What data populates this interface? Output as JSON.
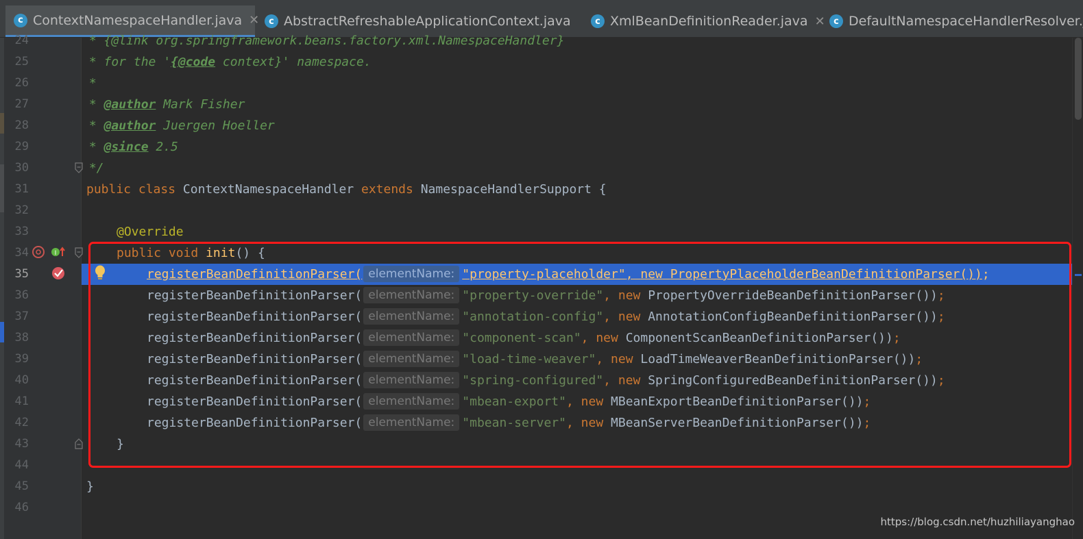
{
  "tabs": [
    {
      "label": "ContextNamespaceHandler.java",
      "icon": "c-class-icon",
      "active": true
    },
    {
      "label": "AbstractRefreshableApplicationContext.java",
      "icon": "c-class-icon",
      "active": false
    },
    {
      "label": "XmlBeanDefinitionReader.java",
      "icon": "c-class-icon",
      "active": false
    },
    {
      "label": "DefaultNamespaceHandlerResolver.j",
      "icon": "c-class-icon",
      "active": false
    }
  ],
  "close_glyph": "✕",
  "class_icon_letter": "c",
  "hint_label": "elementName:",
  "line_numbers": [
    "24",
    "25",
    "26",
    "27",
    "28",
    "29",
    "30",
    "31",
    "32",
    "33",
    "34",
    "35",
    "36",
    "37",
    "38",
    "39",
    "40",
    "41",
    "42",
    "43",
    "44",
    "45",
    "46"
  ],
  "current_line": "35",
  "code": {
    "l24": "{@link org.springframework.beans.factory.xml.NamespaceHandler}",
    "l25_a": " * for the '",
    "l25_tag": "{@code",
    "l25_b": " context}' namespace.",
    "l26": " *",
    "l27_tag": "@author",
    "l27_text": " Mark Fisher",
    "l28_tag": "@author",
    "l28_text": " Juergen Hoeller",
    "l29_tag": "@since",
    "l29_text": " 2.5",
    "l30": " */",
    "l31_public": "public",
    "l31_class": "class",
    "l31_name": "ContextNamespaceHandler",
    "l31_extends": "extends",
    "l31_super": "NamespaceHandlerSupport {",
    "l33_ann": "@Override",
    "l34_public": "public",
    "l34_void": "void",
    "l34_init": "init",
    "l34_rest": "() {",
    "calls": [
      {
        "method": "registerBeanDefinitionParser(",
        "arg": "\"property-placeholder\"",
        "ctor": "PropertyPlaceholderBeanDefinitionParser())",
        "end": ";"
      },
      {
        "method": "registerBeanDefinitionParser(",
        "arg": "\"property-override\"",
        "ctor": "PropertyOverrideBeanDefinitionParser())",
        "end": ";"
      },
      {
        "method": "registerBeanDefinitionParser(",
        "arg": "\"annotation-config\"",
        "ctor": "AnnotationConfigBeanDefinitionParser())",
        "end": ";"
      },
      {
        "method": "registerBeanDefinitionParser(",
        "arg": "\"component-scan\"",
        "ctor": "ComponentScanBeanDefinitionParser())",
        "end": ";"
      },
      {
        "method": "registerBeanDefinitionParser(",
        "arg": "\"load-time-weaver\"",
        "ctor": "LoadTimeWeaverBeanDefinitionParser())",
        "end": ";"
      },
      {
        "method": "registerBeanDefinitionParser(",
        "arg": "\"spring-configured\"",
        "ctor": "SpringConfiguredBeanDefinitionParser())",
        "end": ";"
      },
      {
        "method": "registerBeanDefinitionParser(",
        "arg": "\"mbean-export\"",
        "ctor": "MBeanExportBeanDefinitionParser())",
        "end": ";"
      },
      {
        "method": "registerBeanDefinitionParser(",
        "arg": "\"mbean-server\"",
        "ctor": "MBeanServerBeanDefinitionParser())",
        "end": ";"
      }
    ],
    "comma": ",",
    "new_kw": "new",
    "l43": "}",
    "l45": "}"
  },
  "watermark": "https://blog.csdn.net/huzhiliayanghao",
  "colors": {
    "keyword": "#cc7832",
    "string": "#6a8759",
    "comment": "#629755",
    "annotation": "#bbb529",
    "method_decl": "#ffc66d",
    "selection": "#2f65ca",
    "highlight_box": "#ff1a1a"
  }
}
